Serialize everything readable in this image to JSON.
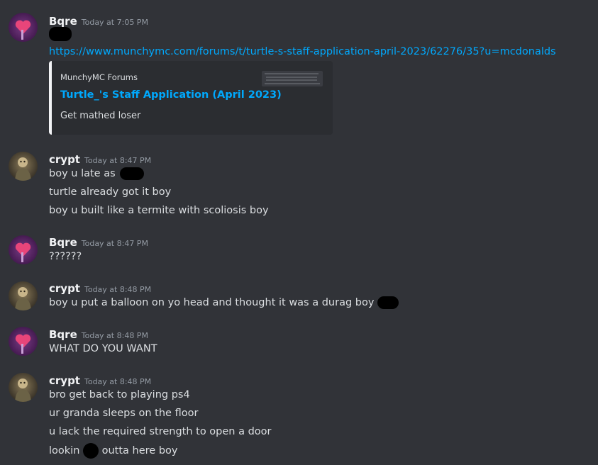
{
  "users": {
    "bqre": "Bqre",
    "crypt": "crypt"
  },
  "groups": [
    {
      "user": "Bqre",
      "time": "Today at 7:05 PM",
      "link": "https://www.munchymc.com/forums/t/turtle-s-staff-application-april-2023/62276/35?u=mcdonalds",
      "embed": {
        "provider": "MunchyMC Forums",
        "title": "Turtle_'s Staff Application (April 2023)",
        "description": "Get mathed loser"
      }
    },
    {
      "user": "crypt",
      "time": "Today at 8:47 PM",
      "lines": [
        "boy u late as",
        "turtle already got it boy",
        "boy u built like a termite with scoliosis boy"
      ]
    },
    {
      "user": "Bqre",
      "time": "Today at 8:47 PM",
      "lines": [
        "??????"
      ]
    },
    {
      "user": "crypt",
      "time": "Today at 8:48 PM",
      "lines": [
        "boy u put a balloon on yo head and thought it was a durag boy"
      ]
    },
    {
      "user": "Bqre",
      "time": "Today at 8:48 PM",
      "lines": [
        "WHAT DO YOU WANT"
      ]
    },
    {
      "user": "crypt",
      "time": "Today at 8:48 PM",
      "lines": [
        "bro get back to playing ps4",
        "ur granda sleeps on the floor",
        "u lack the required strength to open a door",
        "lookin",
        "outta here boy"
      ]
    }
  ],
  "colors": {
    "background": "#313338",
    "link": "#00a8fc",
    "timestamp": "#949ba4",
    "embed_bg": "#2b2d31"
  },
  "icons": {
    "bqre_avatar": "purple-heart-avatar-icon",
    "crypt_avatar": "character-avatar-icon"
  }
}
